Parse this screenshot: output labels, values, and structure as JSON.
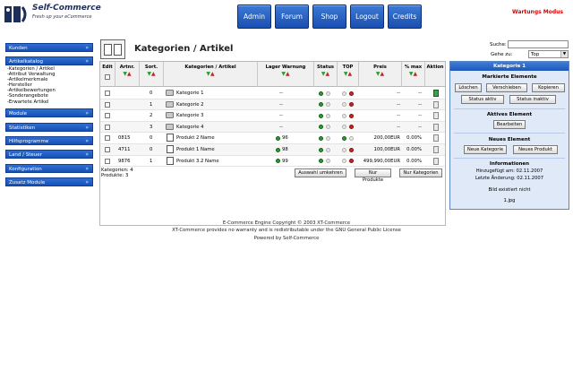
{
  "header": {
    "logo_title": "Self-Commerce",
    "logo_subtitle": "Fresh up your eCommerce",
    "nav": [
      "Admin",
      "Forum",
      "Shop",
      "Logout",
      "Credits"
    ],
    "warning": "Wartungs Modus"
  },
  "sidebar": {
    "sections": [
      "Kunden",
      "Artikelkatalog",
      "Module",
      "Statistiken",
      "Hilfsprogramme",
      "Land / Steuer",
      "Konfiguration",
      "Zusatz Module"
    ],
    "links": [
      "-Kategorien / Artikel",
      "-Attribut Verwaltung",
      "-Artikelmerkmale",
      "-Hersteller",
      "-Artikelbewertungen",
      "-Sonderangebote",
      "-Erwartete Artikel"
    ]
  },
  "page": {
    "title": "Kategorien / Artikel",
    "search_label": "Suche:",
    "search_value": "",
    "goto_label": "Gehe zu:",
    "goto_value": "Top"
  },
  "table": {
    "headers": {
      "edit": "Edit",
      "artnr": "Artnr.",
      "sort": "Sort.",
      "name": "Kategorien / Artikel",
      "lager": "Lager Warnung",
      "status": "Status",
      "top": "TOP",
      "preis": "Preis",
      "max": "% max",
      "aktion": "Aktion"
    },
    "rows": [
      {
        "type": "cat",
        "artnr": "",
        "sort": "0",
        "name": "Kategorie 1",
        "lager": "--",
        "status": "on",
        "top": "off",
        "preis": "--",
        "max": "--",
        "selected": true
      },
      {
        "type": "cat",
        "artnr": "",
        "sort": "1",
        "name": "Kategorie 2",
        "lager": "--",
        "status": "on",
        "top": "off",
        "preis": "--",
        "max": "--",
        "selected": false
      },
      {
        "type": "cat",
        "artnr": "",
        "sort": "2",
        "name": "Kategorie 3",
        "lager": "--",
        "status": "on",
        "top": "off",
        "preis": "--",
        "max": "--",
        "selected": false
      },
      {
        "type": "cat",
        "artnr": "",
        "sort": "3",
        "name": "Kategorie 4",
        "lager": "--",
        "status": "on",
        "top": "off",
        "preis": "--",
        "max": "--",
        "selected": false
      },
      {
        "type": "prod",
        "artnr": "0815",
        "sort": "0",
        "name": "Produkt 2 Name",
        "lager": "96",
        "status": "on",
        "top": "on",
        "preis": "200,00EUR",
        "max": "0.00%",
        "selected": false
      },
      {
        "type": "prod",
        "artnr": "4711",
        "sort": "0",
        "name": "Produkt 1 Name",
        "lager": "98",
        "status": "on",
        "top": "off",
        "preis": "100,00EUR",
        "max": "0.00%",
        "selected": false
      },
      {
        "type": "prod",
        "artnr": "9876",
        "sort": "1",
        "name": "Produkt 3.2 Name",
        "lager": "99",
        "status": "on",
        "top": "off",
        "preis": "499,990,00EUR",
        "max": "0.00%",
        "selected": false
      }
    ],
    "counts": [
      "Kategorien: 4",
      "Produkte: 3"
    ],
    "buttons": [
      "Auswahl umkehren",
      "Nur Produkte",
      "Nur Kategorien"
    ]
  },
  "panel": {
    "title": "Kategorie 1",
    "marked_heading": "Markierte Elemente",
    "marked_buttons": [
      "Löschen",
      "Verschieben",
      "Kopieren"
    ],
    "status_buttons": [
      "Status aktiv",
      "Status inaktiv"
    ],
    "active_heading": "Aktives Element",
    "edit_button": "Bearbeiten",
    "new_heading": "Neues Element",
    "new_buttons": [
      "Neue Kategorie",
      "Neues Produkt"
    ],
    "info_heading": "Informationen",
    "added": "Hinzugefügt am: 02.11.2007",
    "changed": "Letzte Änderung: 02.11.2007",
    "no_image": "Bild existiert nicht",
    "image_name": "1.jpg"
  },
  "footer": {
    "lines": [
      "E-Commerce Engine Copyright © 2003 XT-Commerce",
      "XT-Commerce provides no warranty and is redistributable under the GNU General Public License",
      "Powered by Self-Commerce"
    ]
  },
  "colors": {
    "accent": "#1a4fb0",
    "warning": "#e00000",
    "panel": "#dfe9f8"
  }
}
